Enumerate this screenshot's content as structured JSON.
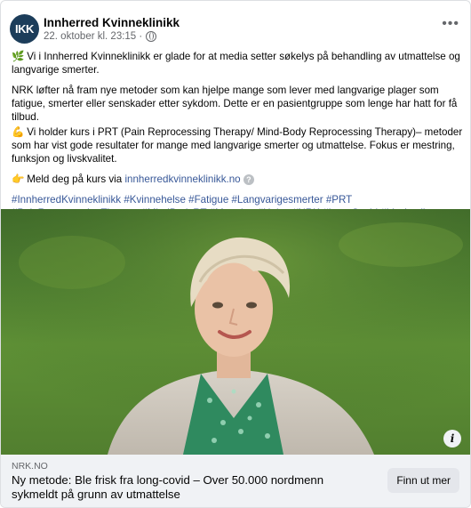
{
  "post": {
    "avatar_text": "IKK",
    "page_name": "Innherred Kvinneklinikk",
    "timestamp": "22. oktober kl. 23:15 ·",
    "more_label": "•••",
    "p1_emoji": "🌿",
    "p1_text": "Vi i Innherred Kvinneklinikk er glade for at media setter søkelys på behandling av utmattelse og langvarige smerter.",
    "p2_text": "NRK løfter nå fram nye metoder som kan hjelpe mange som lever med langvarige plager som fatigue, smerter eller senskader etter sykdom. Dette er en pasientgruppe som lenge har hatt for få tilbud.",
    "p3_emoji": "💪",
    "p3_text": "Vi holder kurs i PRT (Pain Reprocessing Therapy/ Mind-Body Reprocessing Therapy)– metoder som har vist gode resultater for mange med langvarige smerter og utmattelse. Fokus er mestring, funksjon og livskvalitet.",
    "p4_emoji": "👉",
    "p4_text": "Meld deg på kurs via",
    "p4_link": "innherredkvinneklinikk.no",
    "help_label": "?",
    "hashtags": "#InnherredKvinneklinikk #Kvinnehelse #Fatigue #Langvarigesmerter #PRT #PainReprocessingTherapy #MindBodyRT #Mestring #Helse #NRK #LongCovid #Livskvalitet #Kurs"
  },
  "link_preview": {
    "domain": "NRK.NO",
    "headline": "Ny metode: Ble frisk fra long-covid – Over 50.000 nordmenn sykmeldt på grunn av utmattelse",
    "cta": "Finn ut mer",
    "info_label": "i"
  }
}
